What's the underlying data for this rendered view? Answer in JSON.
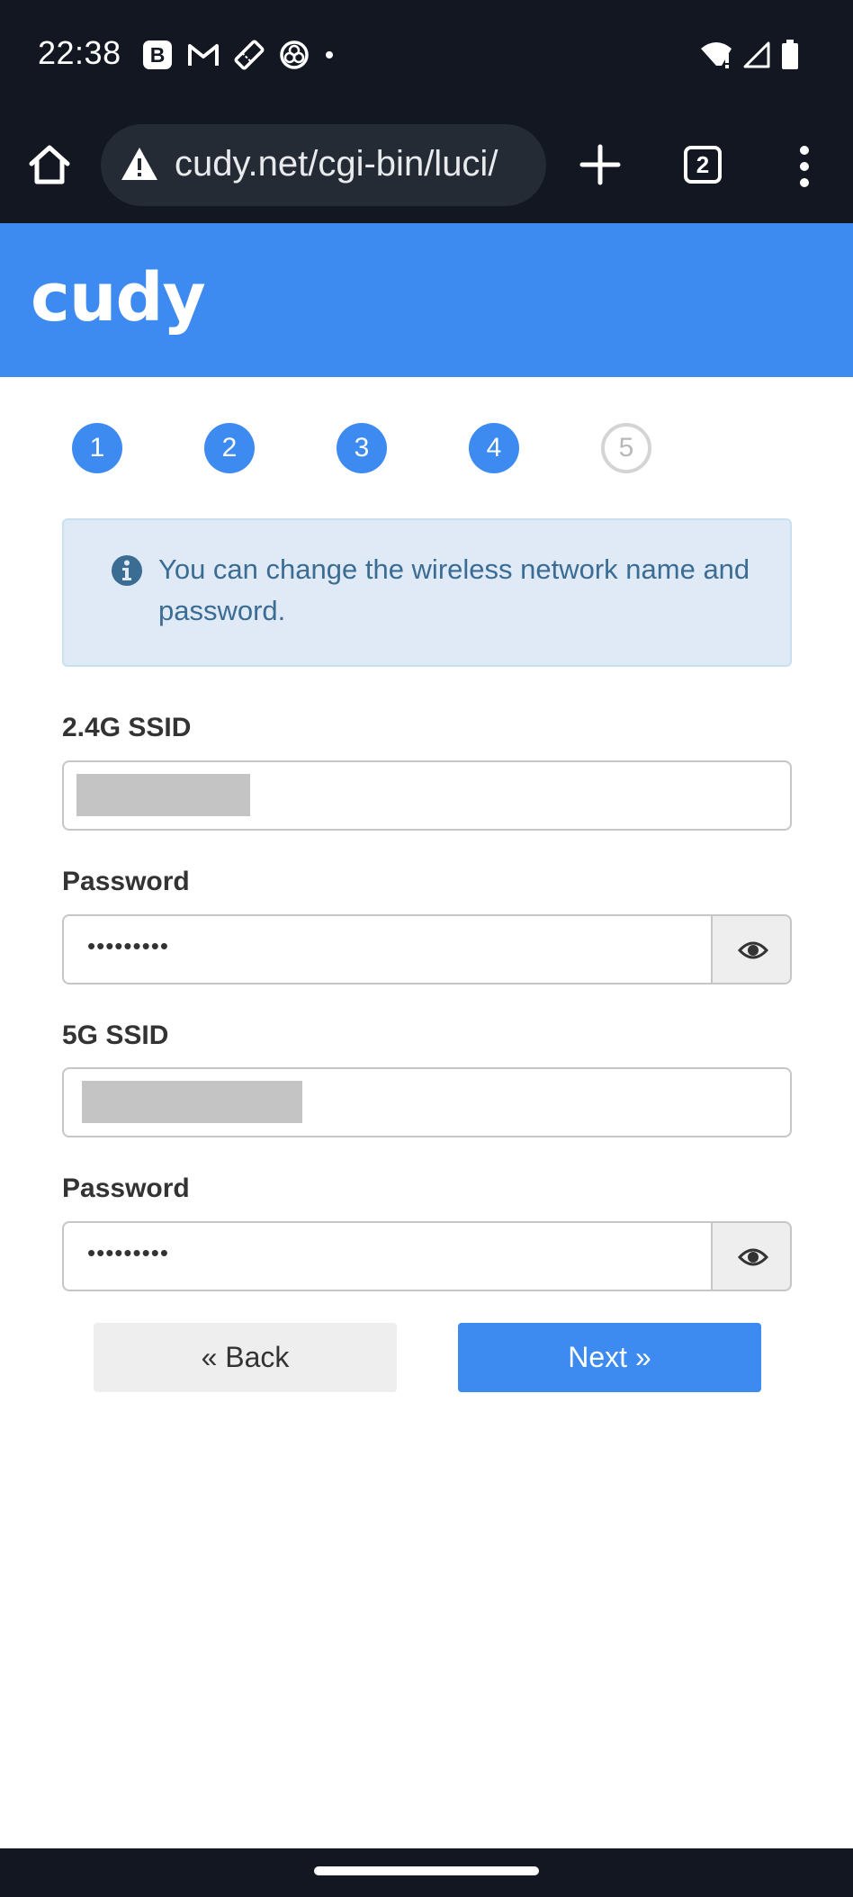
{
  "status_bar": {
    "time": "22:38",
    "icons": [
      "b-app-icon",
      "gmail-icon",
      "ticket-icon",
      "app-icon",
      "notification-dot-icon",
      "wifi-icon",
      "cell-signal-icon",
      "battery-icon"
    ]
  },
  "browser": {
    "url": "cudy.net/cgi-bin/luci/",
    "tab_count": "2",
    "icons": [
      "home-icon",
      "warning-icon",
      "plus-icon",
      "tabs-icon",
      "more-vert-icon"
    ]
  },
  "header": {
    "logo": "cudy",
    "color": "#3d8bf0"
  },
  "steps": [
    {
      "label": "1",
      "state": "done"
    },
    {
      "label": "2",
      "state": "done"
    },
    {
      "label": "3",
      "state": "done"
    },
    {
      "label": "4",
      "state": "done"
    },
    {
      "label": "5",
      "state": "todo"
    }
  ],
  "info": {
    "icon": "info-icon",
    "text": "You can change the wireless network name and password."
  },
  "form": {
    "ssid_24": {
      "label": "2.4G SSID",
      "value": ""
    },
    "password_24": {
      "label": "Password",
      "masked_value": "•••••••••",
      "toggle_icon": "eye-icon"
    },
    "ssid_5": {
      "label": "5G SSID",
      "value": ""
    },
    "password_5": {
      "label": "Password",
      "masked_value": "•••••••••",
      "toggle_icon": "eye-icon"
    }
  },
  "buttons": {
    "back": "« Back",
    "next": "Next »"
  },
  "colors": {
    "accent": "#3d8bf0",
    "dark_bar": "#131722",
    "info_bg": "#dfeaf6",
    "info_text": "#3b6c93"
  }
}
